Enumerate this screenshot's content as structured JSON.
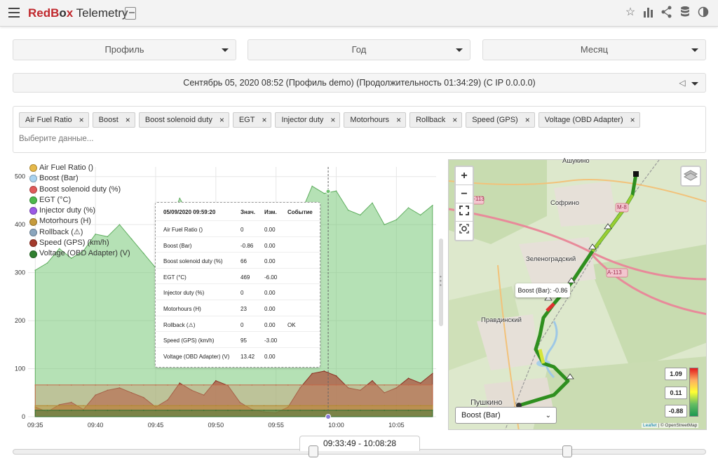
{
  "app": {
    "brand_red": "RedB",
    "brand_red2": "x",
    "brand_dark": " Telemetry",
    "brand_o": "o"
  },
  "header": {
    "icons": [
      "star-icon",
      "bar-chart-icon",
      "share-icon",
      "database-icon",
      "contrast-icon"
    ]
  },
  "filters": {
    "profile": "Профиль",
    "year": "Год",
    "month": "Месяц"
  },
  "session": {
    "text": "Сентябрь 05, 2020 08:52 (Профиль demo) (Продолжительность 01:34:29) (С IP 0.0.0.0)"
  },
  "selection": {
    "tags": [
      "Air Fuel Ratio",
      "Boost",
      "Boost solenoid duty",
      "EGT",
      "Injector duty",
      "Motorhours",
      "Rollback",
      "Speed (GPS)",
      "Voltage (OBD Adapter)"
    ],
    "placeholder": "Выберите данные..."
  },
  "legend": [
    {
      "label": "Air Fuel Ratio ()",
      "color": "#e6b94a"
    },
    {
      "label": "Boost (Bar)",
      "color": "#a9d3f0"
    },
    {
      "label": "Boost solenoid duty (%)",
      "color": "#e05a5a"
    },
    {
      "label": "EGT (°C)",
      "color": "#4cb84c"
    },
    {
      "label": "Injector duty (%)",
      "color": "#9b59e6"
    },
    {
      "label": "Motorhours (H)",
      "color": "#c59a3c"
    },
    {
      "label": "Rollback (⚠)",
      "color": "#8aa5bd"
    },
    {
      "label": "Speed (GPS) (km/h)",
      "color": "#a33a2c"
    },
    {
      "label": "Voltage (OBD Adapter) (V)",
      "color": "#2f7f2f"
    }
  ],
  "chart_data": {
    "type": "area",
    "x": [
      "09:35",
      "09:36",
      "09:37",
      "09:38",
      "09:39",
      "09:40",
      "09:41",
      "09:42",
      "09:43",
      "09:44",
      "09:45",
      "09:46",
      "09:47",
      "09:48",
      "09:49",
      "09:50",
      "09:51",
      "09:52",
      "09:53",
      "09:54",
      "09:55",
      "09:56",
      "09:57",
      "09:58",
      "09:59",
      "10:00",
      "10:01",
      "10:02",
      "10:03",
      "10:04",
      "10:05",
      "10:06",
      "10:07",
      "10:08"
    ],
    "xticks": [
      "09:35",
      "09:40",
      "09:45",
      "09:50",
      "09:55",
      "10:00",
      "10:05"
    ],
    "ylim": [
      0,
      520
    ],
    "yticks": [
      0,
      100,
      200,
      300,
      400,
      500
    ],
    "series": [
      {
        "name": "EGT (°C)",
        "values": [
          305,
          320,
          350,
          330,
          345,
          380,
          375,
          400,
          370,
          340,
          310,
          390,
          455,
          410,
          395,
          440,
          420,
          350,
          320,
          330,
          310,
          340,
          420,
          480,
          465,
          470,
          430,
          420,
          445,
          400,
          410,
          435,
          420,
          440
        ]
      },
      {
        "name": "Speed (GPS) (km/h)",
        "values": [
          20,
          10,
          25,
          30,
          15,
          45,
          55,
          60,
          50,
          40,
          20,
          35,
          70,
          55,
          45,
          75,
          65,
          30,
          15,
          10,
          8,
          20,
          60,
          90,
          95,
          85,
          60,
          55,
          75,
          50,
          60,
          80,
          70,
          90
        ]
      },
      {
        "name": "Boost solenoid duty (%)",
        "values": [
          66,
          66,
          66,
          66,
          66,
          66,
          66,
          66,
          66,
          66,
          66,
          66,
          66,
          66,
          66,
          66,
          66,
          66,
          66,
          66,
          66,
          66,
          66,
          66,
          66,
          66,
          66,
          66,
          66,
          66,
          66,
          66,
          66,
          66
        ]
      },
      {
        "name": "Motorhours (H)",
        "values": [
          23,
          23,
          23,
          23,
          23,
          23,
          23,
          23,
          23,
          23,
          23,
          23,
          23,
          23,
          23,
          23,
          23,
          23,
          23,
          23,
          23,
          23,
          23,
          23,
          23,
          23,
          23,
          23,
          23,
          23,
          23,
          23,
          23,
          23
        ]
      },
      {
        "name": "Voltage (OBD Adapter) (V)",
        "values": [
          13.4,
          13.4,
          13.4,
          13.4,
          13.4,
          13.4,
          13.4,
          13.4,
          13.4,
          13.4,
          13.4,
          13.4,
          13.4,
          13.4,
          13.4,
          13.4,
          13.4,
          13.4,
          13.4,
          13.4,
          13.4,
          13.4,
          13.4,
          13.4,
          13.4,
          13.4,
          13.4,
          13.4,
          13.4,
          13.4,
          13.4,
          13.4,
          13.4,
          13.4
        ]
      }
    ],
    "cursor_x": "09:59:20"
  },
  "tooltip": {
    "timestamp": "05/09/2020 09:59:20",
    "col_value": "Знач.",
    "col_change": "Изм.",
    "col_event": "Событие",
    "rows": [
      {
        "name": "Air Fuel Ratio ()",
        "value": "0",
        "change": "0.00",
        "event": ""
      },
      {
        "name": "Boost (Bar)",
        "value": "-0.86",
        "change": "0.00",
        "event": ""
      },
      {
        "name": "Boost solenoid duty (%)",
        "value": "66",
        "change": "0.00",
        "event": ""
      },
      {
        "name": "EGT (°C)",
        "value": "469",
        "change": "-6.00",
        "event": ""
      },
      {
        "name": "Injector duty (%)",
        "value": "0",
        "change": "0.00",
        "event": ""
      },
      {
        "name": "Motorhours (H)",
        "value": "23",
        "change": "0.00",
        "event": ""
      },
      {
        "name": "Rollback (⚠)",
        "value": "0",
        "change": "0.00",
        "event": "OK"
      },
      {
        "name": "Speed (GPS) (km/h)",
        "value": "95",
        "change": "-3.00",
        "event": ""
      },
      {
        "name": "Voltage (OBD Adapter) (V)",
        "value": "13.42",
        "change": "0.00",
        "event": ""
      }
    ]
  },
  "map": {
    "zoom_in": "+",
    "zoom_out": "−",
    "labels": [
      "Ашукино",
      "Софрино",
      "Зеленоградский",
      "Правдинский",
      "Пушкино",
      "A-113",
      "A-113",
      "M-8"
    ],
    "popup": "Boost (Bar): -0.86",
    "select_value": "Boost (Bar)",
    "scale": [
      "1.09",
      "0.11",
      "-0.88"
    ],
    "attribution_leaf": "Leaflet",
    "attribution_rest": " | © OpenStreetMap"
  },
  "range": {
    "label": "09:33:49 - 10:08:28"
  }
}
